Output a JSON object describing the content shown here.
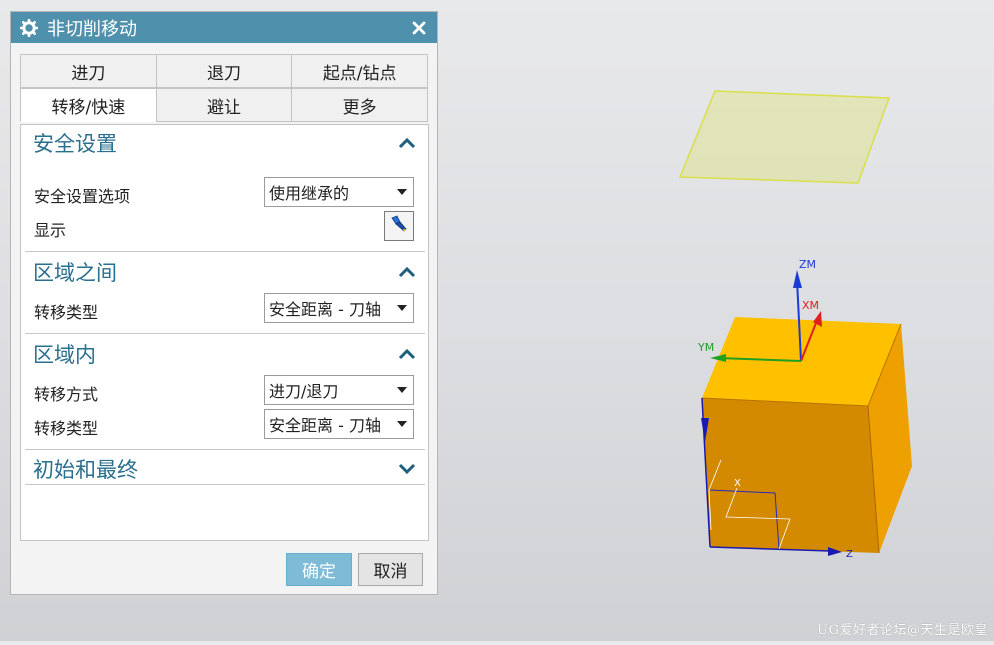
{
  "dialog": {
    "title": "非切削移动",
    "title_icon": "gear-icon",
    "close_icon": "close-icon",
    "title_bar_color": "#4f91ad"
  },
  "tabs": {
    "row1": [
      "进刀",
      "退刀",
      "起点/钻点"
    ],
    "row2": [
      "转移/快速",
      "避让",
      "更多"
    ],
    "active": "转移/快速"
  },
  "sections": {
    "safety": {
      "title": "安全设置",
      "option_label": "安全设置选项",
      "option_value": "使用继承的",
      "display_label": "显示",
      "expanded": true
    },
    "between_regions": {
      "title": "区域之间",
      "transfer_type_label": "转移类型",
      "transfer_type_value": "安全距离 - 刀轴",
      "expanded": true
    },
    "within_region": {
      "title": "区域内",
      "transfer_method_label": "转移方式",
      "transfer_method_value": "进刀/退刀",
      "transfer_type_label": "转移类型",
      "transfer_type_value": "安全距离 - 刀轴",
      "expanded": true
    },
    "initial_final": {
      "title": "初始和最终",
      "expanded": false
    }
  },
  "buttons": {
    "ok": "确定",
    "cancel": "取消"
  },
  "viewport": {
    "axis_labels": {
      "zm": "ZM",
      "xm": "XM",
      "ym": "YM",
      "x": "X",
      "z": "Z"
    },
    "block_top_color": "#ffc000",
    "block_front_color": "#d48a00",
    "block_side_color": "#eea000",
    "safety_plane_color": "#dfe39a"
  },
  "watermark": "UG爱好者论坛@天生是欧皇"
}
